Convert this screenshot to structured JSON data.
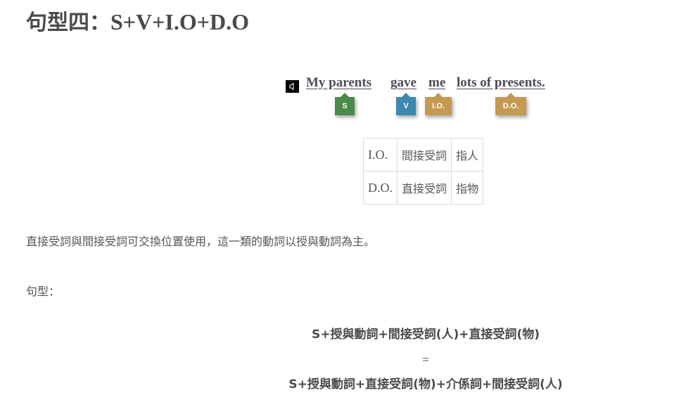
{
  "title": {
    "cjk": "句型四：",
    "formula": "S+V+I.O+D.O"
  },
  "example": {
    "speaker_icon": "speaker-icon",
    "words": {
      "subject": "My parents",
      "verb": "gave",
      "indirect_object": "me",
      "direct_object": "lots of presents."
    },
    "tags": {
      "subject": "S",
      "verb": "V",
      "indirect_object": "I.O.",
      "direct_object": "D.O."
    },
    "tag_colors": {
      "subject": "#4a8a4a",
      "verb": "#3d88b0",
      "object": "#c49a52"
    }
  },
  "definitions": {
    "rows": [
      {
        "abbr": "I.O.",
        "name": "間接受詞",
        "refers": "指人"
      },
      {
        "abbr": "D.O.",
        "name": "直接受詞",
        "refers": "指物"
      }
    ]
  },
  "description": "直接受詞與間接受詞可交換位置使用，這一類的動詞以授與動詞為主。",
  "pattern_label": "句型：",
  "formulas": {
    "first": "S+授與動詞+間接受詞(人)+直接受詞(物)",
    "equals": "=",
    "second": "S+授與動詞+直接受詞(物)+介係詞+間接受詞(人)"
  }
}
